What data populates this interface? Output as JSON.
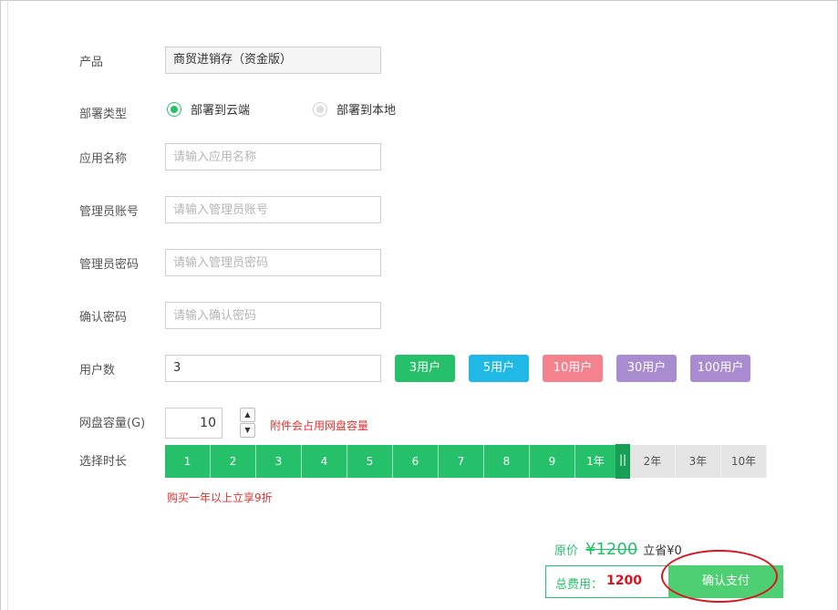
{
  "form": {
    "product": {
      "label": "产品",
      "value": "商贸进销存（资金版）"
    },
    "deploy": {
      "label": "部署类型",
      "options": [
        "部署到云端",
        "部署到本地"
      ],
      "selected": "部署到云端"
    },
    "app_name": {
      "label": "应用名称",
      "placeholder": "请输入应用名称",
      "value": ""
    },
    "admin_account": {
      "label": "管理员账号",
      "placeholder": "请输入管理员账号",
      "value": ""
    },
    "admin_password": {
      "label": "管理员密码",
      "placeholder": "请输入管理员密码",
      "value": ""
    },
    "confirm_password": {
      "label": "确认密码",
      "placeholder": "请输入确认密码",
      "value": ""
    },
    "users": {
      "label": "用户数",
      "value": "3",
      "presets": [
        {
          "label": "3用户",
          "color": "#27c06a"
        },
        {
          "label": "5用户",
          "color": "#20b9e6"
        },
        {
          "label": "10用户",
          "color": "#f3818e"
        },
        {
          "label": "30用户",
          "color": "#a98bd0"
        },
        {
          "label": "100用户",
          "color": "#a98bd0"
        }
      ]
    },
    "disk": {
      "label": "网盘容量(G)",
      "value": "10",
      "note": "附件会占用网盘容量",
      "up_glyph": "▲",
      "down_glyph": "▼"
    },
    "duration": {
      "label": "选择时长",
      "options": [
        "1",
        "2",
        "3",
        "4",
        "5",
        "6",
        "7",
        "8",
        "9",
        "1年",
        "2年",
        "3年",
        "10年"
      ],
      "selected": "1年",
      "handle_glyph": "||",
      "note": "购买一年以上立享9折"
    }
  },
  "summary": {
    "original_label": "原价",
    "original_price": "¥1200",
    "saved_text": "立省¥0",
    "total_label": "总费用：",
    "total_value": "1200",
    "pay_label": "确认支付"
  },
  "colors": {
    "accent": "#27c06a",
    "price_red": "#e0101b",
    "annotation_red": "#d9161f"
  }
}
